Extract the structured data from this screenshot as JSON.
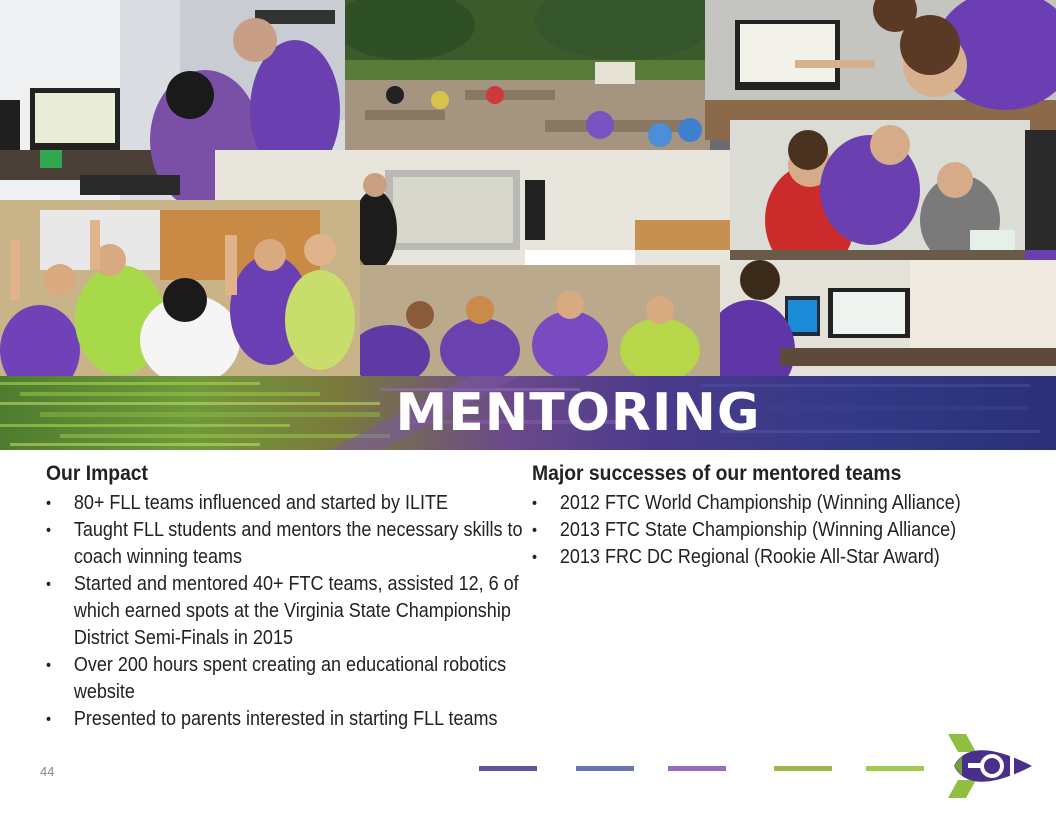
{
  "banner": {
    "title": "MENTORING"
  },
  "left": {
    "heading": "Our Impact",
    "items": [
      "80+ FLL teams influenced and started by ILITE",
      "Taught FLL students and mentors the necessary skills to coach winning teams",
      "Started and mentored 40+ FTC teams, assisted 12, 6 of which earned spots at the Virginia State Championship District Semi-Finals in 2015",
      "Over 200 hours spent creating an educational robotics website",
      "Presented to parents interested in starting FLL teams"
    ]
  },
  "right": {
    "heading": "Major successes of our mentored teams",
    "items": [
      "2012 FTC World Championship (Winning Alliance)",
      "2013 FTC State Championship  (Winning Alliance)",
      "2013 FRC DC Regional (Rookie All-Star Award)"
    ]
  },
  "page_number": "44",
  "colors": {
    "purple": "#5b3f8f",
    "green": "#7ab648",
    "navy": "#2e3080",
    "lavender": "#8a6fc2"
  },
  "footer": {
    "dash_colors": [
      "#5a56a0",
      "#6a73b3",
      "#9a6bb8",
      "#9db84a",
      "#a3c94f"
    ]
  },
  "logo": {
    "icon": "rocket-logo-icon"
  }
}
